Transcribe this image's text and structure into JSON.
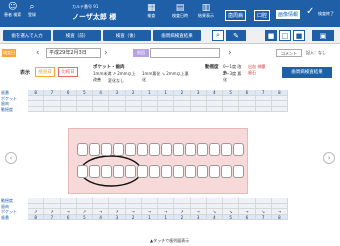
{
  "topbar": {
    "items": [
      {
        "icon": "person-icon",
        "label": "患者 検索"
      },
      {
        "icon": "search-icon",
        "label": "登録"
      }
    ],
    "patient_id": "カルテ番号 91",
    "patient_name": "ノーザ太郎 様",
    "nav": [
      {
        "icon": "grid-icon",
        "label": "検査"
      },
      {
        "icon": "doc-icon",
        "label": "検査日時"
      },
      {
        "icon": "chart-icon",
        "label": "結果表示"
      }
    ],
    "modes": [
      "歯周病",
      "口腔",
      "画像情報"
    ],
    "right_label": "検査終了"
  },
  "buttons": {
    "b1": "歯を選んで入力",
    "b2": "検査（前）",
    "b3": "検査（後）",
    "b4": "歯周病検査結果"
  },
  "date": {
    "tag": "検査日",
    "value": "平成29年2月3日",
    "alt": "前回",
    "comment_label": "コメント",
    "right_text": "記入：なし"
  },
  "legend": {
    "display_label": "表示",
    "tab1": "検査日",
    "tab2": "比較日",
    "pocket_title": "ポケット・歯肉",
    "items": [
      "1mm未満 ↗ 2mm以上改善",
      "1mm悪化 ↘ 2mm以上悪化",
      "変化なし"
    ],
    "mobility_title": "動揺度",
    "mobility_items": [
      "0〜1度 改善",
      "2〜3度 悪化",
      "出血 排膿 歯石"
    ],
    "button": "歯周病検査結果"
  },
  "grid_top": {
    "rows": [
      "歯番",
      "ポケット",
      "歯肉",
      "動揺度"
    ],
    "numbers": [
      "8",
      "7",
      "6",
      "5",
      "4",
      "3",
      "2",
      "1",
      "1",
      "2",
      "3",
      "4",
      "5",
      "6",
      "7",
      "8"
    ]
  },
  "grid_bottom": {
    "rows": [
      "動揺度",
      "歯肉",
      "ポケット",
      "歯番"
    ],
    "marks": [
      "↗",
      "↗",
      "→",
      "↗",
      "→",
      "↗",
      "→",
      "→",
      "→",
      "↗",
      "→",
      "↘",
      "↘",
      "→",
      "↘",
      "→"
    ]
  },
  "footer": "▲タッチで歯列図表示"
}
